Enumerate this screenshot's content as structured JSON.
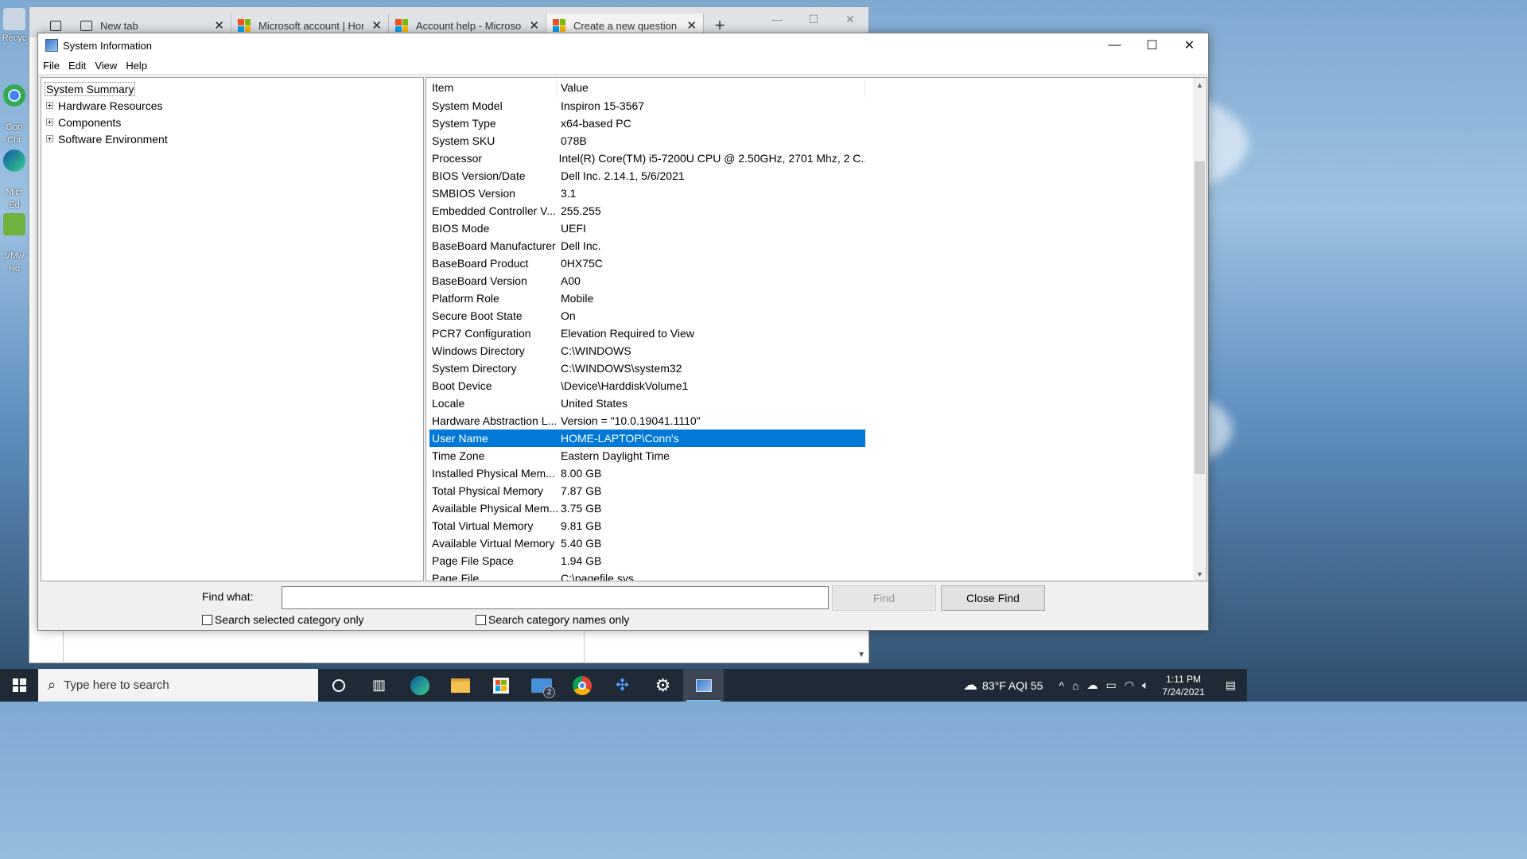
{
  "desktop": {
    "icons": [
      {
        "label": "Recyc"
      },
      {
        "label": "Goo\nChr"
      },
      {
        "label": "Micr\nEd"
      },
      {
        "label": "VMw\nHo"
      }
    ]
  },
  "browser": {
    "tabs": [
      {
        "label": "New tab"
      },
      {
        "label": "Microsoft account | Hon"
      },
      {
        "label": "Account help - Microsof"
      },
      {
        "label": "Create a new question o"
      }
    ],
    "new_tab_glyph": "+",
    "close_glyph": "✕"
  },
  "window": {
    "title": "System Information",
    "menu": [
      "File",
      "Edit",
      "View",
      "Help"
    ],
    "controls": {
      "minimize": "—",
      "maximize": "☐",
      "close": "✕"
    }
  },
  "tree": {
    "root": "System Summary",
    "children": [
      "Hardware Resources",
      "Components",
      "Software Environment"
    ]
  },
  "table": {
    "columns": [
      "Item",
      "Value"
    ],
    "selected_row": "User Name",
    "rows": [
      {
        "item": "System Model",
        "value": "Inspiron 15-3567"
      },
      {
        "item": "System Type",
        "value": "x64-based PC"
      },
      {
        "item": "System SKU",
        "value": "078B"
      },
      {
        "item": "Processor",
        "value": "Intel(R) Core(TM) i5-7200U CPU @ 2.50GHz, 2701 Mhz, 2 C..."
      },
      {
        "item": "BIOS Version/Date",
        "value": "Dell Inc. 2.14.1, 5/6/2021"
      },
      {
        "item": "SMBIOS Version",
        "value": "3.1"
      },
      {
        "item": "Embedded Controller V...",
        "value": "255.255"
      },
      {
        "item": "BIOS Mode",
        "value": "UEFI"
      },
      {
        "item": "BaseBoard Manufacturer",
        "value": "Dell Inc."
      },
      {
        "item": "BaseBoard Product",
        "value": "0HX75C"
      },
      {
        "item": "BaseBoard Version",
        "value": "A00"
      },
      {
        "item": "Platform Role",
        "value": "Mobile"
      },
      {
        "item": "Secure Boot State",
        "value": "On"
      },
      {
        "item": "PCR7 Configuration",
        "value": "Elevation Required to View"
      },
      {
        "item": "Windows Directory",
        "value": "C:\\WINDOWS"
      },
      {
        "item": "System Directory",
        "value": "C:\\WINDOWS\\system32"
      },
      {
        "item": "Boot Device",
        "value": "\\Device\\HarddiskVolume1"
      },
      {
        "item": "Locale",
        "value": "United States"
      },
      {
        "item": "Hardware Abstraction L...",
        "value": "Version = \"10.0.19041.1110\""
      },
      {
        "item": "User Name",
        "value": "HOME-LAPTOP\\Conn's"
      },
      {
        "item": "Time Zone",
        "value": "Eastern Daylight Time"
      },
      {
        "item": "Installed Physical Mem...",
        "value": "8.00 GB"
      },
      {
        "item": "Total Physical Memory",
        "value": "7.87 GB"
      },
      {
        "item": "Available Physical Mem...",
        "value": "3.75 GB"
      },
      {
        "item": "Total Virtual Memory",
        "value": "9.81 GB"
      },
      {
        "item": "Available Virtual Memory",
        "value": "5.40 GB"
      },
      {
        "item": "Page File Space",
        "value": "1.94 GB"
      },
      {
        "item": "Page File",
        "value": "C:\\pagefile.sys"
      }
    ]
  },
  "find": {
    "label": "Find what:",
    "value": "",
    "find_button": "Find",
    "close_find_button": "Close Find",
    "check_selected_category": "Search selected category only",
    "check_category_names": "Search category names only"
  },
  "taskbar": {
    "search_placeholder": "Type here to search",
    "mail_badge": "2",
    "weather": "83°F  AQI 55",
    "time": "1:11 PM",
    "date": "7/24/2021"
  },
  "colors": {
    "selection": "#0078d7",
    "taskbar": "#1f2a36",
    "ms_red": "#f25022",
    "ms_green": "#7fba00",
    "ms_blue": "#00a4ef",
    "ms_yellow": "#ffb900"
  }
}
